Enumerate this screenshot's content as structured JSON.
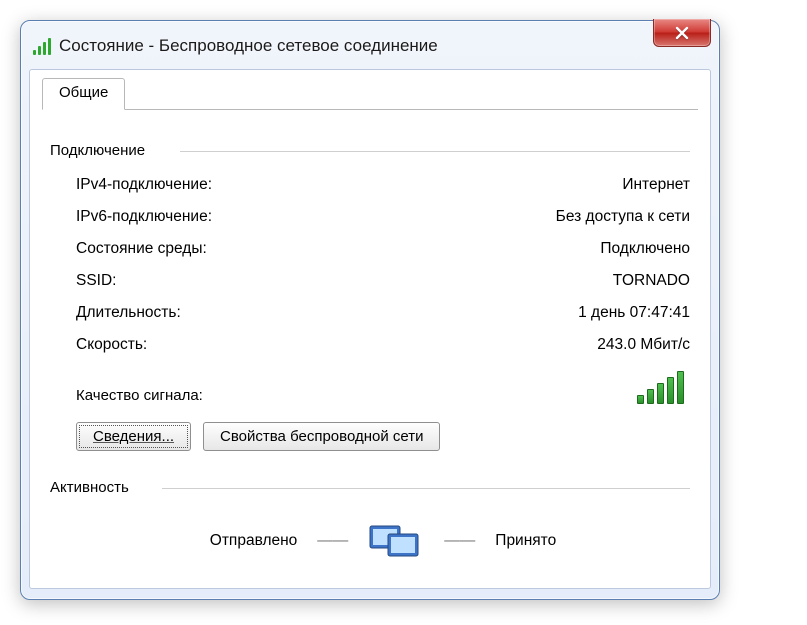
{
  "window": {
    "title": "Состояние - Беспроводное сетевое соединение"
  },
  "tab": {
    "general": "Общие"
  },
  "connection": {
    "group_label": "Подключение",
    "ipv4_label": "IPv4-подключение:",
    "ipv4_value": "Интернет",
    "ipv6_label": "IPv6-подключение:",
    "ipv6_value": "Без доступа к сети",
    "media_label": "Состояние среды:",
    "media_value": "Подключено",
    "ssid_label": "SSID:",
    "ssid_value": "TORNADO",
    "duration_label": "Длительность:",
    "duration_value": "1 день 07:47:41",
    "speed_label": "Скорость:",
    "speed_value": "243.0 Мбит/с",
    "signal_label": "Качество сигнала:"
  },
  "buttons": {
    "details": "Сведения...",
    "wifi_props": "Свойства беспроводной сети"
  },
  "activity": {
    "group_label": "Активность",
    "sent": "Отправлено",
    "received": "Принято"
  }
}
